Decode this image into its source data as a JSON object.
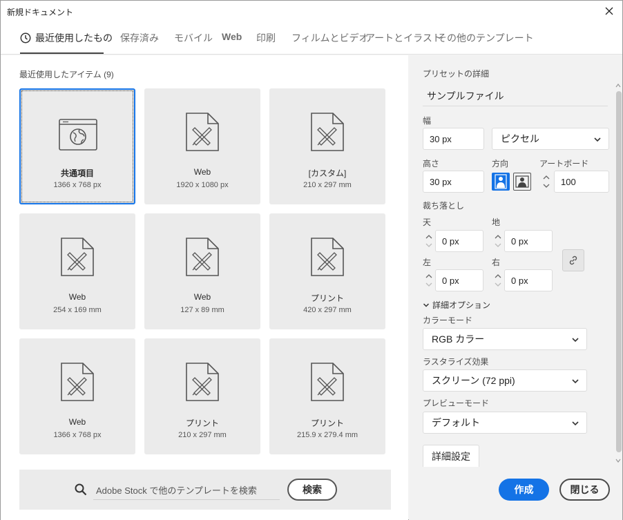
{
  "window": {
    "title": "新規ドキュメント"
  },
  "tabs": [
    {
      "label": "最近使用したもの",
      "active": true
    },
    {
      "label": "保存済み"
    },
    {
      "label": "モバイル"
    },
    {
      "label": "Web"
    },
    {
      "label": "印刷"
    },
    {
      "label": "フィルムとビデオ"
    },
    {
      "label": "アートとイラスト"
    },
    {
      "label": "その他のテンプレート"
    }
  ],
  "recent": {
    "label": "最近使用したアイテム (9)",
    "items": [
      {
        "name": "共通項目",
        "size": "1366 x 768 px",
        "icon": "web-globe-icon",
        "selected": true
      },
      {
        "name": "Web",
        "size": "1920 x 1080 px",
        "icon": "document-pen-ruler-icon"
      },
      {
        "name": "[カスタム]",
        "size": "210 x 297 mm",
        "icon": "document-pen-ruler-icon"
      },
      {
        "name": "Web",
        "size": "254 x 169 mm",
        "icon": "document-pen-ruler-icon"
      },
      {
        "name": "Web",
        "size": "127 x 89 mm",
        "icon": "document-pen-ruler-icon"
      },
      {
        "name": "プリント",
        "size": "420 x 297 mm",
        "icon": "document-pen-ruler-icon"
      },
      {
        "name": "Web",
        "size": "1366 x 768 px",
        "icon": "document-pen-ruler-icon"
      },
      {
        "name": "プリント",
        "size": "210 x 297 mm",
        "icon": "document-pen-ruler-icon"
      },
      {
        "name": "プリント",
        "size": "215.9 x 279.4 mm",
        "icon": "document-pen-ruler-icon"
      }
    ]
  },
  "stock": {
    "placeholder": "Adobe Stock で他のテンプレートを検索",
    "search_label": "検索"
  },
  "preset": {
    "header": "プリセットの詳細",
    "name": "サンプルファイル",
    "width_label": "幅",
    "width_value": "30 px",
    "unit": "ピクセル",
    "height_label": "高さ",
    "height_value": "30 px",
    "orientation_label": "方向",
    "artboards_label": "アートボード",
    "artboards_value": "100",
    "bleed_label": "裁ち落とし",
    "bleed": {
      "top_label": "天",
      "top_value": "0 px",
      "bottom_label": "地",
      "bottom_value": "0 px",
      "left_label": "左",
      "left_value": "0 px",
      "right_label": "右",
      "right_value": "0 px"
    },
    "advanced_label": "詳細オプション",
    "color_mode_label": "カラーモード",
    "color_mode": "RGB カラー",
    "raster_label": "ラスタライズ効果",
    "raster": "スクリーン (72 ppi)",
    "preview_label": "プレビューモード",
    "preview": "デフォルト",
    "more_settings": "詳細設定"
  },
  "actions": {
    "create": "作成",
    "close": "閉じる"
  },
  "colors": {
    "accent": "#1473e6",
    "panel": "#f2f2f2",
    "card": "#ebebeb"
  }
}
